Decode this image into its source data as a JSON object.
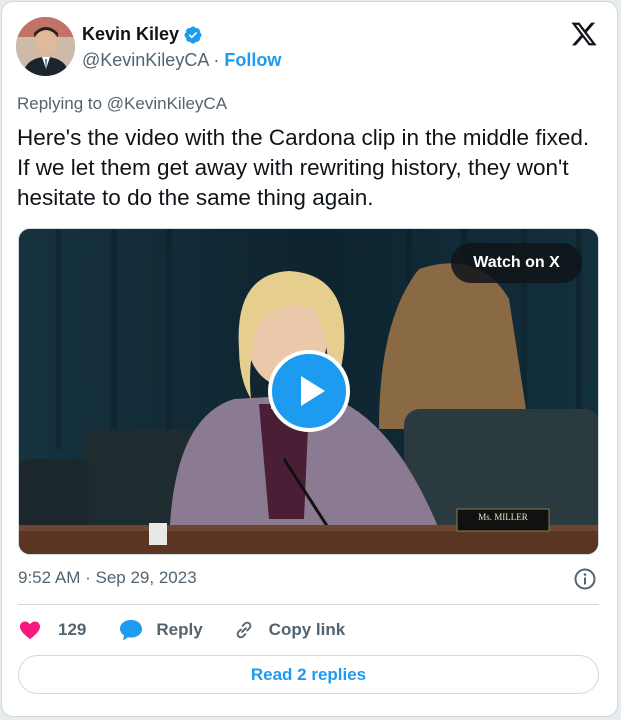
{
  "author": {
    "name": "Kevin Kiley",
    "handle": "@KevinKileyCA",
    "separator": "·",
    "follow_label": "Follow"
  },
  "replying": {
    "prefix": "Replying to",
    "handle": "@KevinKileyCA"
  },
  "tweet": {
    "text": "Here's the video with the Cardona clip in the middle fixed. If we let them get away with rewriting history, they won't hesitate to do the same thing again."
  },
  "media": {
    "watch_label": "Watch on X",
    "nameplate": "Ms. MILLER"
  },
  "meta": {
    "time": "9:52 AM",
    "separator": "·",
    "date": "Sep 29, 2023"
  },
  "actions": {
    "likes": "129",
    "reply_label": "Reply",
    "copy_label": "Copy link"
  },
  "footer": {
    "read_replies_label": "Read 2 replies"
  },
  "colors": {
    "accent": "#1d9bf0",
    "like": "#f91880",
    "text": "#0f1419",
    "muted": "#536471"
  },
  "icons": [
    "verified-badge-icon",
    "x-logo-icon",
    "play-icon",
    "info-icon",
    "heart-icon",
    "reply-bubble-icon",
    "link-icon"
  ]
}
